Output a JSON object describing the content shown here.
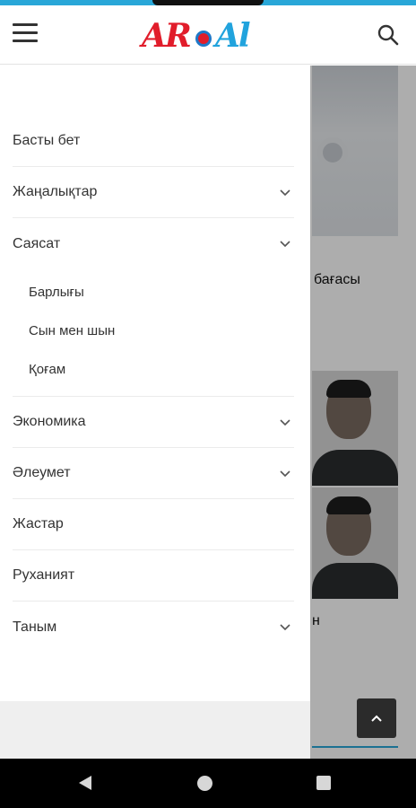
{
  "header": {
    "logo_left": "AR",
    "logo_right": "Al",
    "menu_icon": "hamburger-icon",
    "search_icon": "search-icon"
  },
  "drawer": {
    "items": [
      {
        "label": "Басты бет",
        "has_children": false
      },
      {
        "label": "Жаңалықтар",
        "has_children": true
      },
      {
        "label": "Саясат",
        "has_children": true,
        "expanded": true,
        "children": [
          "Барлығы",
          "Сын мен шын",
          "Қоғам"
        ]
      },
      {
        "label": "Экономика",
        "has_children": true
      },
      {
        "label": "Әлеумет",
        "has_children": true
      },
      {
        "label": "Жастар",
        "has_children": false
      },
      {
        "label": "Руханият",
        "has_children": false
      },
      {
        "label": "Таным",
        "has_children": true
      }
    ]
  },
  "background_page": {
    "headline_fragment": "бағасы",
    "text_fragment": "н"
  },
  "colors": {
    "accent": "#29a7d8",
    "logo_red": "#e11d2b",
    "logo_blue": "#21a3dd",
    "overlay": "rgba(0,0,0,0.32)"
  },
  "system_nav": {
    "back_icon": "back-triangle-icon",
    "home_icon": "home-circle-icon",
    "recents_icon": "recents-square-icon"
  },
  "scroll_top_icon": "chevron-up-icon"
}
